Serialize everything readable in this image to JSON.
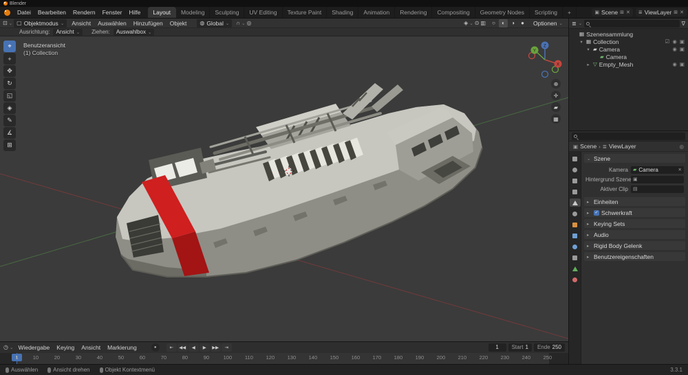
{
  "window": {
    "title": "Blender"
  },
  "colors": {
    "accent": "#4772b3",
    "stripe_red": "#cf1f1f",
    "axis_x": "#c4463e",
    "axis_y": "#6aa33c",
    "axis_z": "#4a72b5"
  },
  "icons": {
    "caret": "⌄",
    "editor": "⊡",
    "cube": "▢",
    "globe": "◍",
    "magnet": "∩",
    "proportional": "◎",
    "gizmo": "◈",
    "overlays": "⊙",
    "xray": "▥",
    "shading": [
      "○",
      "◐",
      "◑",
      "●"
    ],
    "clock": "◷",
    "record": "●",
    "funnel": "∇",
    "pin": "◎",
    "layers": "≣",
    "scene_mini": "▣",
    "add": "⊞",
    "close": "✕",
    "crumb_sep": "›"
  },
  "topbar": {
    "menus": [
      "Datei",
      "Bearbeiten",
      "Rendern",
      "Fenster",
      "Hilfe"
    ],
    "tabs": [
      "Layout",
      "Modeling",
      "Sculpting",
      "UV Editing",
      "Texture Paint",
      "Shading",
      "Animation",
      "Rendering",
      "Compositing",
      "Geometry Nodes",
      "Scripting",
      "+"
    ],
    "active_tab": "Layout",
    "scene_label": "Scene",
    "viewlayer_label": "ViewLayer"
  },
  "viewport_header": {
    "mode_label": "Objektmodus",
    "menus": [
      "Ansicht",
      "Auswählen",
      "Hinzufügen",
      "Objekt"
    ],
    "orientation_label": "Global",
    "options_label": "Optionen"
  },
  "tool_settings": {
    "orientation_label": "Ausrichtung:",
    "orientation_value": "Ansicht",
    "drag_label": "Ziehen:",
    "drag_value": "Auswahlbox"
  },
  "viewport": {
    "view_label": "Benutzeransicht",
    "collection_label": "(1) Collection",
    "gizmo_axes": {
      "x": "X",
      "y": "Y",
      "z": "Z"
    },
    "tools": [
      {
        "name": "select-box-tool",
        "glyph": "⌖",
        "active": true
      },
      {
        "name": "cursor-tool",
        "glyph": "+",
        "active": false
      },
      {
        "name": "move-tool",
        "glyph": "✥",
        "active": false
      },
      {
        "name": "rotate-tool",
        "glyph": "↻",
        "active": false
      },
      {
        "name": "scale-tool",
        "glyph": "◱",
        "active": false
      },
      {
        "name": "transform-tool",
        "glyph": "◈",
        "active": false
      },
      {
        "name": "annotate-tool",
        "glyph": "✎",
        "active": false
      },
      {
        "name": "measure-tool",
        "glyph": "∡",
        "active": false
      },
      {
        "name": "add-cube-tool",
        "glyph": "⊞",
        "active": false
      }
    ],
    "nav_icons": [
      {
        "name": "zoom-icon",
        "glyph": "⊕"
      },
      {
        "name": "pan-icon",
        "glyph": "✛"
      },
      {
        "name": "camera-view-icon",
        "glyph": "▰"
      },
      {
        "name": "perspective-toggle-icon",
        "glyph": "▦"
      }
    ]
  },
  "outliner": {
    "rows": [
      {
        "depth": 0,
        "expander": "",
        "icon": "scene-collection-icon",
        "glyph": "▦",
        "color": "#c4c4c4",
        "label": "Szenensammlung",
        "toggles": []
      },
      {
        "depth": 1,
        "expander": "▾",
        "icon": "collection-icon",
        "glyph": "▦",
        "color": "#c4c4c4",
        "label": "Collection",
        "toggles": [
          "checkbox",
          "eye",
          "camera"
        ]
      },
      {
        "depth": 2,
        "expander": "▾",
        "icon": "camera-object-icon",
        "glyph": "▰",
        "color": "#d0d0d0",
        "label": "Camera",
        "toggles": [
          "eye",
          "camera"
        ]
      },
      {
        "depth": 3,
        "expander": "",
        "icon": "camera-data-icon",
        "glyph": "▰",
        "color": "#6db46d",
        "label": "Camera",
        "toggles": []
      },
      {
        "depth": 2,
        "expander": "▸",
        "icon": "mesh-icon",
        "glyph": "▽",
        "color": "#7ec57e",
        "label": "Empty_Mesh",
        "toggles": [
          "eye",
          "camera"
        ]
      }
    ]
  },
  "properties": {
    "breadcrumb": {
      "scene": "Scene",
      "viewlayer": "ViewLayer"
    },
    "tabs": [
      {
        "name": "tool-tab",
        "shape": "square",
        "color": "#9a9a9a",
        "active": false
      },
      {
        "name": "render-tab",
        "shape": "circle",
        "color": "#9a9a9a",
        "active": false
      },
      {
        "name": "output-tab",
        "shape": "square",
        "color": "#9a9a9a",
        "active": false
      },
      {
        "name": "view-layer-tab",
        "shape": "square",
        "color": "#9a9a9a",
        "active": false
      },
      {
        "name": "scene-tab",
        "shape": "triangle",
        "color": "#c9c9c9",
        "active": true
      },
      {
        "name": "world-tab",
        "shape": "circle",
        "color": "#9a9a9a",
        "active": false
      },
      {
        "name": "object-tab",
        "shape": "square",
        "color": "#d8913f",
        "active": false
      },
      {
        "name": "modifiers-tab",
        "shape": "square",
        "color": "#6f9fd4",
        "active": false
      },
      {
        "name": "physics-tab",
        "shape": "circle",
        "color": "#6f9fd4",
        "active": false
      },
      {
        "name": "constraints-tab",
        "shape": "square",
        "color": "#9a9a9a",
        "active": false
      },
      {
        "name": "data-tab",
        "shape": "triangle",
        "color": "#65b05e",
        "active": false
      },
      {
        "name": "material-tab",
        "shape": "circle",
        "color": "#d36a6a",
        "active": false
      }
    ],
    "scene_panel": {
      "title": "Szene",
      "fields": [
        {
          "label": "Kamera",
          "value": "Camera",
          "icon": "camera-data-icon",
          "glyph": "▰",
          "glyph_color": "#6db46d",
          "clearable": true
        },
        {
          "label": "Hintergrund Szene",
          "value": "",
          "icon": "scene-icon",
          "glyph": "▣",
          "glyph_color": "#9a9a9a",
          "clearable": false
        },
        {
          "label": "Aktiver Clip",
          "value": "",
          "icon": "clip-icon",
          "glyph": "▤",
          "glyph_color": "#9a9a9a",
          "clearable": false
        }
      ]
    },
    "sections": [
      {
        "label": "Einheiten",
        "checkbox": false
      },
      {
        "label": "Schwerkraft",
        "checkbox": true
      },
      {
        "label": "Keying Sets",
        "checkbox": false
      },
      {
        "label": "Audio",
        "checkbox": false
      },
      {
        "label": "Rigid Body Gelenk",
        "checkbox": false
      },
      {
        "label": "Benutzereigenschaften",
        "checkbox": false
      }
    ]
  },
  "timeline": {
    "menus": [
      "Wiedergabe",
      "Keying",
      "Ansicht",
      "Markierung"
    ],
    "transport": [
      {
        "name": "jump-start-button",
        "glyph": "⇤"
      },
      {
        "name": "prev-keyframe-button",
        "glyph": "◀◀"
      },
      {
        "name": "play-reverse-button",
        "glyph": "◀"
      },
      {
        "name": "play-button",
        "glyph": "▶"
      },
      {
        "name": "next-keyframe-button",
        "glyph": "▶▶"
      },
      {
        "name": "jump-end-button",
        "glyph": "⇥"
      }
    ],
    "current_frame": "1",
    "start_label": "Start",
    "start_value": "1",
    "end_label": "Ende",
    "end_value": "250",
    "frame_range": {
      "start": 1,
      "end": 250
    },
    "ruler_frames": [
      1,
      10,
      20,
      30,
      40,
      50,
      60,
      70,
      80,
      90,
      100,
      110,
      120,
      130,
      140,
      150,
      160,
      170,
      180,
      190,
      200,
      210,
      220,
      230,
      240,
      250
    ]
  },
  "statusbar": {
    "items": [
      "Auswählen",
      "Ansicht drehen",
      "Objekt Kontextmenü"
    ],
    "version": "3.3.1"
  }
}
